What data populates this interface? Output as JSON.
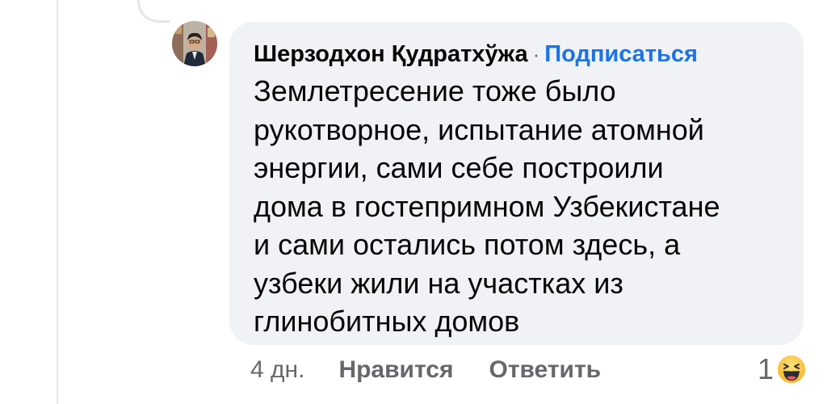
{
  "comment": {
    "author": "Шерзодхон Қудратхўжа",
    "separator": "·",
    "follow_label": "Подписаться",
    "text_lines": [
      "Землетресение тоже было",
      "рукотворное, испытание атомной",
      "энергии, сами себе построили",
      "дома в гостепримном Узбекистане",
      "и сами остались потом здесь, а",
      "узбеки жили на участках из",
      "глинобитных домов"
    ]
  },
  "actions": {
    "timestamp": "4 дн.",
    "like_label": "Нравится",
    "reply_label": "Ответить"
  },
  "reactions": {
    "count": "1",
    "icon": "haha-emoji-icon"
  },
  "colors": {
    "bubble": "#f0f2f5",
    "link": "#1b74e4",
    "secondary_text": "#65676b",
    "primary_text": "#050505"
  }
}
